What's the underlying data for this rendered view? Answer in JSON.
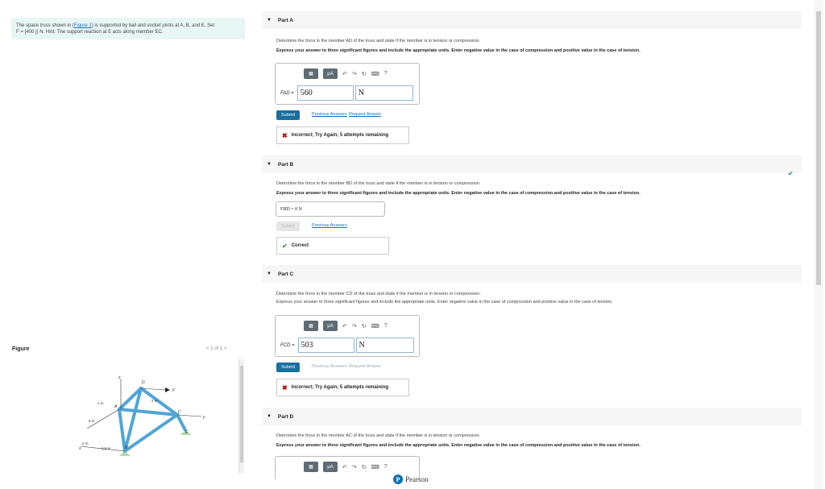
{
  "problem": {
    "pre": "The space truss shown in (",
    "link": "Figure 1",
    "post": ") is supported by ball and socket joints at A, B, and E. Set",
    "line2": "F = {400 j} N. Hint: The support reaction at E acts along member EC."
  },
  "figure": {
    "label": "Figure",
    "pager": "1 of 1",
    "labels": {
      "z": "z",
      "D": "D",
      "F": "F",
      "A": "A",
      "C": "C",
      "y": "y",
      "B": "B",
      "E": "E",
      "x": "x",
      "d1m": "1 m",
      "d2m_top": "2 m",
      "d5m": "5 m",
      "d2m": "2 m",
      "d15m": "1.5 m"
    }
  },
  "parts": [
    {
      "title": "Part A",
      "q1": "Determine the force in the member AD of the truss and state if the member is in tension or compression.",
      "q2": "Express your answer to three significant figures and include the appropriate units. Enter negative value in the case of compression and positive value in the case of tension.",
      "label": "FAD =",
      "value": "560",
      "unit": "N",
      "submit": "Submit",
      "links": [
        "Previous Answers",
        "Request Answer"
      ],
      "feedback": "Incorrect; Try Again; 5 attempts remaining"
    },
    {
      "title": "Part B",
      "q1": "Determine the force in the member BD of the truss and state if the member is in tension or compression.",
      "q2": "Express your answer to three significant figures and include the appropriate units. Enter negative value in the case of compression and positive value in the case of tension.",
      "answer": "FBD = 0 N",
      "submit": "Submit",
      "links": [
        "Previous Answers"
      ],
      "feedback": "Correct"
    },
    {
      "title": "Part C",
      "q1": "Determine the force in the member CD of the truss and state if the member is in tension or compression.",
      "q2": "Express your answer to three significant figures and include the appropriate units. Enter negative value in the case of compression and positive value in the case of tension.",
      "label": "FCD =",
      "value": "503",
      "unit": "N",
      "submit": "Submit",
      "links": [
        "Previous Answers",
        "Request Answer"
      ],
      "feedback": "Incorrect; Try Again; 5 attempts remaining"
    },
    {
      "title": "Part D",
      "q1": "Determine the force in the member AC of the truss and state if the member is in tension or compression.",
      "q2": "Express your answer to three significant figures and include the appropriate units. Enter negative value in the case of compression and positive value in the case of tension."
    }
  ],
  "toolbar": {
    "mu": "μA",
    "help": "?"
  },
  "footer": {
    "brand": "Pearson",
    "logo": "P"
  },
  "colors": {
    "submit": "#1a6f9e",
    "error": "#c00000",
    "correct": "#3a9a3a",
    "accent": "#1a6fb5"
  }
}
